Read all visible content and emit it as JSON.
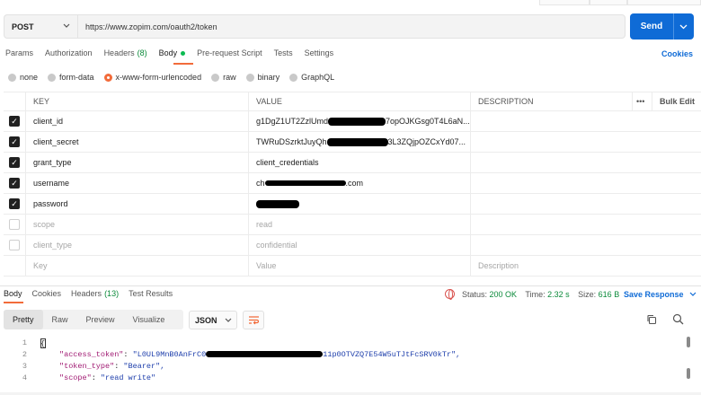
{
  "request": {
    "method": "POST",
    "url": "https://www.zopim.com/oauth2/token",
    "send_label": "Send"
  },
  "tabs": {
    "params": "Params",
    "authorization": "Authorization",
    "headers": "Headers",
    "headers_count": "(8)",
    "body": "Body",
    "pre_request": "Pre-request Script",
    "tests": "Tests",
    "settings": "Settings",
    "cookies": "Cookies"
  },
  "body_types": {
    "none": "none",
    "form_data": "form-data",
    "urlencoded": "x-www-form-urlencoded",
    "raw": "raw",
    "binary": "binary",
    "graphql": "GraphQL"
  },
  "table": {
    "headers": {
      "key": "KEY",
      "value": "VALUE",
      "description": "DESCRIPTION",
      "more": "•••",
      "bulk_edit": "Bulk Edit"
    },
    "rows": [
      {
        "key": "client_id",
        "value_pre": "g1DgZ1UT2ZzlUmd",
        "value_post": "7opOJKGsg0T4L6aN...",
        "checked": true
      },
      {
        "key": "client_secret",
        "value_pre": "TWRuDSzrktJuyQh",
        "value_post": "3L3ZQjpOZCxYd07...",
        "checked": true
      },
      {
        "key": "grant_type",
        "value_pre": "client_credentials",
        "value_post": "",
        "checked": true
      },
      {
        "key": "username",
        "value_pre": "ch",
        "value_post": ".com",
        "checked": true
      },
      {
        "key": "password",
        "value_pre": "",
        "value_post": "",
        "checked": true
      },
      {
        "key": "scope",
        "value_pre": "read",
        "value_post": "",
        "checked": false
      },
      {
        "key": "client_type",
        "value_pre": "confidential",
        "value_post": "",
        "checked": false
      }
    ],
    "placeholder": {
      "key": "Key",
      "value": "Value",
      "description": "Description"
    }
  },
  "response": {
    "tabs": {
      "body": "Body",
      "cookies": "Cookies",
      "headers": "Headers",
      "headers_count": "(13)",
      "test_results": "Test Results"
    },
    "status_label": "Status:",
    "status_value": "200 OK",
    "time_label": "Time:",
    "time_value": "2.32 s",
    "size_label": "Size:",
    "size_value": "616 B",
    "save_response": "Save Response",
    "views": {
      "pretty": "Pretty",
      "raw": "Raw",
      "preview": "Preview",
      "visualize": "Visualize"
    },
    "format": "JSON",
    "code": {
      "line1": "{",
      "access_token_key": "\"access_token\"",
      "access_token_pre": "\"L0UL9MnB0AnFrC0",
      "access_token_post": "11p0OTVZQ7E54W5uTJtFcSRV0kTr\",",
      "token_type_key": "\"token_type\"",
      "token_type_val": "\"Bearer\",",
      "scope_key": "\"scope\"",
      "scope_val": "\"read write\"",
      "line_numbers": [
        "1",
        "2",
        "3",
        "4"
      ]
    }
  },
  "colors": {
    "accent": "#f26b3a",
    "send": "#0f6bd6",
    "ok": "#0b8a3a"
  }
}
